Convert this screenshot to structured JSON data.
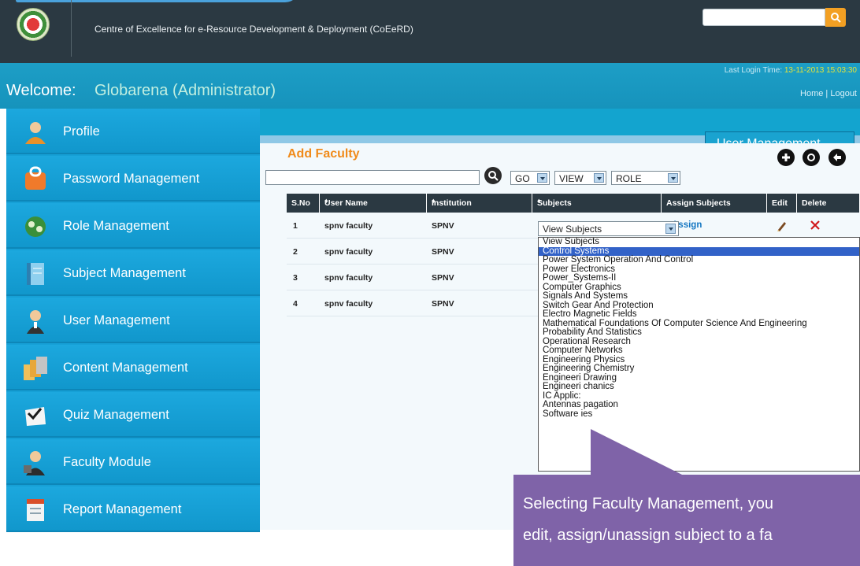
{
  "header": {
    "org_title": "Centre of Excellence for e-Resource Development & Deployment (CoEeRD)",
    "search_placeholder": ""
  },
  "welcome": {
    "label": "Welcome:",
    "user": "Globarena (Administrator)",
    "last_login_label": "Last Login Time:",
    "last_login_time": "13-11-2013 15:03:30",
    "links": {
      "home": "Home",
      "separator": "|",
      "logout": "Logout"
    }
  },
  "sidebar": {
    "items": [
      {
        "label": "Profile",
        "icon": "profile-icon"
      },
      {
        "label": "Password Management",
        "icon": "lock-icon"
      },
      {
        "label": "Role Management",
        "icon": "role-icon"
      },
      {
        "label": "Subject Management",
        "icon": "notebook-icon"
      },
      {
        "label": "User Management",
        "icon": "user-icon"
      },
      {
        "label": "Content Management",
        "icon": "folders-icon"
      },
      {
        "label": "Quiz Management",
        "icon": "quiz-icon"
      },
      {
        "label": "Faculty Module",
        "icon": "faculty-icon"
      },
      {
        "label": "Report Management",
        "icon": "report-icon"
      }
    ]
  },
  "main": {
    "section_tab": "User Management",
    "form_title": "Add Faculty",
    "filters": {
      "search_value": "",
      "go_label": "GO",
      "view_label": "VIEW",
      "role_label": "ROLE"
    },
    "table": {
      "columns": [
        "S.No",
        "User Name",
        "Institution",
        "Subjects",
        "Assign Subjects",
        "Edit",
        "Delete"
      ],
      "rows": [
        {
          "sno": "1",
          "user": "spnv faculty",
          "inst": "SPNV"
        },
        {
          "sno": "2",
          "user": "spnv faculty",
          "inst": "SPNV"
        },
        {
          "sno": "3",
          "user": "spnv faculty",
          "inst": "SPNV"
        },
        {
          "sno": "4",
          "user": "spnv faculty",
          "inst": "SPNV"
        }
      ],
      "assign_label": "Assign"
    },
    "subjects_dropdown": {
      "selected": "View Subjects",
      "options": [
        "View Subjects",
        "Control Systems",
        "Power System Operation And Control",
        "Power Electronics",
        "Power_Systems-II",
        "Computer Graphics",
        "Signals And Systems",
        "Switch Gear And Protection",
        "Electro Magnetic Fields",
        "Mathematical Foundations Of Computer Science And Engineering",
        "Probability And Statistics",
        "Operational Research",
        "Computer Networks",
        "Engineering Physics",
        "Engineering Chemistry",
        "Engineeri   Drawing",
        "Engineeri      chanics",
        "IC Applic:",
        "Antennas                  pagation",
        "Software                  ies"
      ],
      "highlighted_index": 1
    }
  },
  "callout": {
    "line1": "Selecting Faculty Management, you",
    "line2": "edit, assign/unassign subject to a fa"
  },
  "colors": {
    "header_bg": "#2b3942",
    "sidebar_bg": "#16a0d6",
    "accent_orange": "#f08b1b",
    "callout_bg": "#7f63a8"
  }
}
